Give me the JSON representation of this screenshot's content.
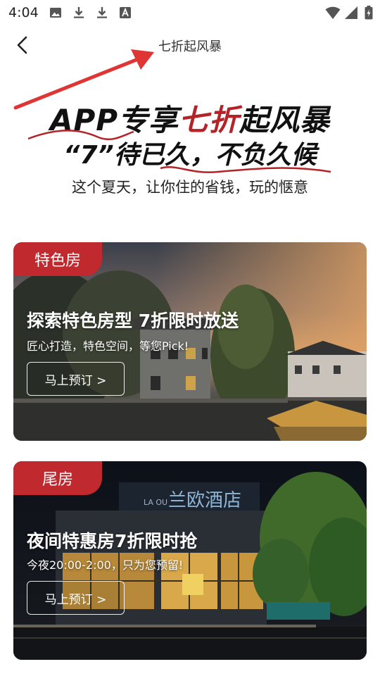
{
  "status_bar": {
    "time": "4:04",
    "icons_left": [
      "image-icon",
      "download-icon",
      "download-icon",
      "text-icon"
    ],
    "icons_right": [
      "wifi-icon",
      "signal-icon",
      "battery-charging-icon"
    ]
  },
  "header": {
    "back_icon": "chevron-left-icon",
    "title": "七折起风暴"
  },
  "banner": {
    "line1_prefix": "APP专享",
    "line1_highlight": "七折",
    "line1_suffix": "起风暴",
    "line2": "“7”待已久，不负久候",
    "line3": "这个夏天，让你住的省钱，玩的惬意",
    "accent_color": "#b42328"
  },
  "cards": [
    {
      "tag": "特色房",
      "title": "探索特色房型  7折限时放送",
      "subtitle": "匠心打造，特色空间，等您Pick!",
      "button": "马上预订 >"
    },
    {
      "tag": "尾房",
      "title": "夜间特惠房7折限时抢",
      "subtitle": "今夜20:00-2:00，只为您预留!",
      "button": "马上预订 >",
      "sign_text": "兰欧酒店"
    }
  ],
  "colors": {
    "tag_bg": "#c0292e",
    "annotation_arrow": "#e03535"
  }
}
